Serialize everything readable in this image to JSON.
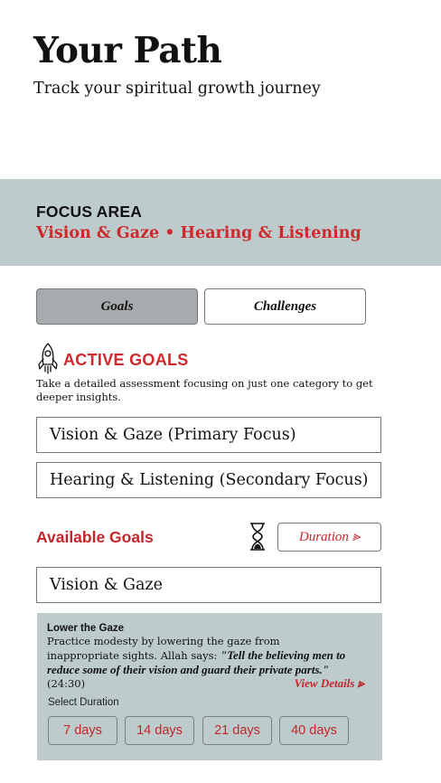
{
  "header": {
    "title": "Your Path",
    "subtitle": "Track your spiritual growth journey"
  },
  "focus": {
    "label": "FOCUS AREA",
    "value": "Vision & Gaze • Hearing & Listening"
  },
  "tabs": [
    {
      "label": "Goals",
      "selected": true
    },
    {
      "label": "Challenges",
      "selected": false
    }
  ],
  "active_goals": {
    "icon": "rocket-icon",
    "title": "ACTIVE GOALS",
    "description": "Take a detailed assessment focusing on just one category to get deeper insights.",
    "items": [
      "Vision & Gaze (Primary Focus)",
      "Hearing & Listening (Secondary Focus)"
    ]
  },
  "available_goals": {
    "title": "Available Goals",
    "icon": "hourglass-icon",
    "duration_label": "Duration ⪢",
    "filter_value": "Vision & Gaze",
    "card": {
      "title": "Lower the Gaze",
      "body": "Practice modesty by lowering the gaze from inappropriate sights. Allah says: ",
      "quote": "\"Tell the believing men to reduce some of their vision and guard their private parts.\"",
      "reference": " (24:30)",
      "view_details": "View Details ⪢",
      "select_label": "Select Duration",
      "durations": [
        "7 days",
        "14 days",
        "21 days",
        "40 days"
      ]
    }
  },
  "colors": {
    "accent_red": "#d0292b",
    "band_gray": "#bdcbcd",
    "selected_tab": "#a8abad"
  }
}
